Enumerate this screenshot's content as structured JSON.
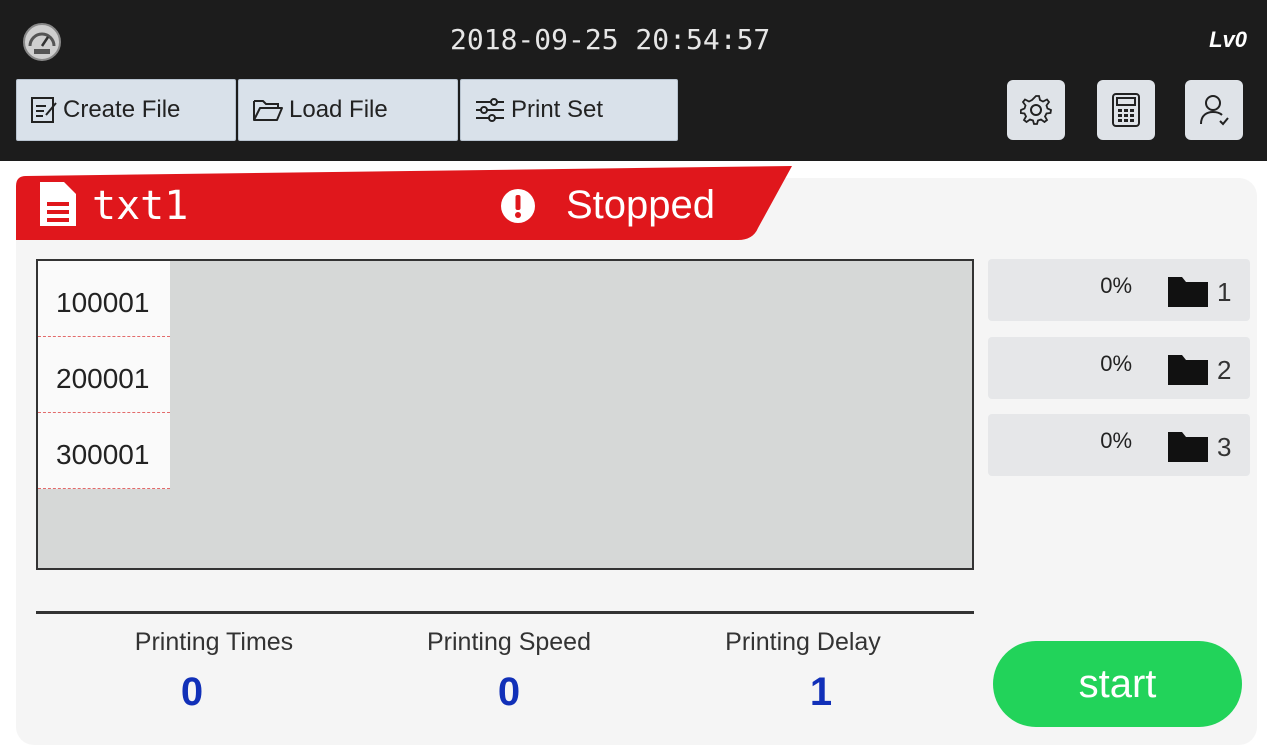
{
  "header": {
    "datetime": "2018-09-25 20:54:57",
    "level": "Lv0"
  },
  "toolbar": {
    "create_file": "Create File",
    "load_file": "Load File",
    "print_set": "Print Set"
  },
  "job": {
    "file_name": "txt1",
    "status": "Stopped"
  },
  "preview_rows": [
    "100001",
    "200001",
    "300001"
  ],
  "ink_levels": [
    {
      "percent": "0%",
      "number": "1"
    },
    {
      "percent": "0%",
      "number": "2"
    },
    {
      "percent": "0%",
      "number": "3"
    }
  ],
  "stats": {
    "times_label": "Printing Times",
    "times_value": "0",
    "speed_label": "Printing Speed",
    "speed_value": "0",
    "delay_label": "Printing Delay",
    "delay_value": "1"
  },
  "start_label": "start",
  "colors": {
    "status_red": "#e0171c",
    "start_green": "#22d35a",
    "value_blue": "#1130b8",
    "topbar": "#1c1c1c"
  }
}
